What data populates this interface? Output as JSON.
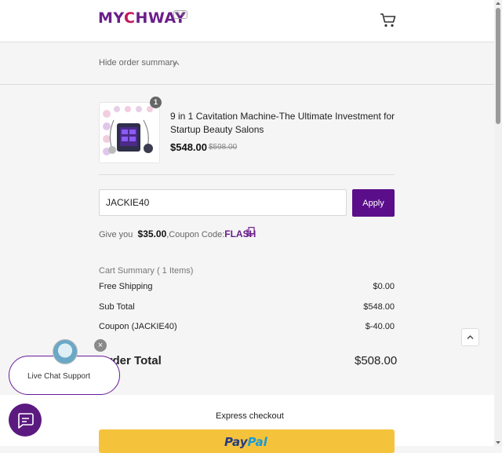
{
  "header": {
    "logo_left": "MY",
    "logo_c": "C",
    "logo_right": "HWAY",
    "logo_badge": "® ©",
    "cart_icon": "shopping-cart-icon"
  },
  "summary_toggle": {
    "label": "Hide order summary",
    "icon": "chevron-up-icon"
  },
  "product": {
    "quantity": "1",
    "title": "9 in 1 Cavitation Machine-The Ultimate Investment for Startup Beauty Salons",
    "price": "$548.00",
    "old_price": "$598.00"
  },
  "coupon": {
    "input_value": "JACKIE40",
    "apply_label": "Apply",
    "give_prefix": "Give you",
    "give_amount": "$35.00",
    "code_prefix": ",Coupon Code:",
    "code": "FLASH",
    "copy_icon": "copy-icon"
  },
  "cart_summary": {
    "title": "Cart Summary ( 1 Items)",
    "rows": [
      {
        "label": "Free Shipping",
        "value": "$0.00"
      },
      {
        "label": "Sub Total",
        "value": "$548.00"
      },
      {
        "label": "Coupon (JACKIE40)",
        "value": "$-40.00"
      }
    ],
    "order_total_label": "Order Total",
    "order_total_value": "$508.00"
  },
  "express": {
    "label": "Express checkout",
    "paypal_pay": "Pay",
    "paypal_pal": "Pal"
  },
  "chat": {
    "label": "Live Chat Support",
    "close": "×"
  },
  "colors": {
    "brand": "#5b0e8a",
    "paypal_yellow": "#f5c33b"
  }
}
